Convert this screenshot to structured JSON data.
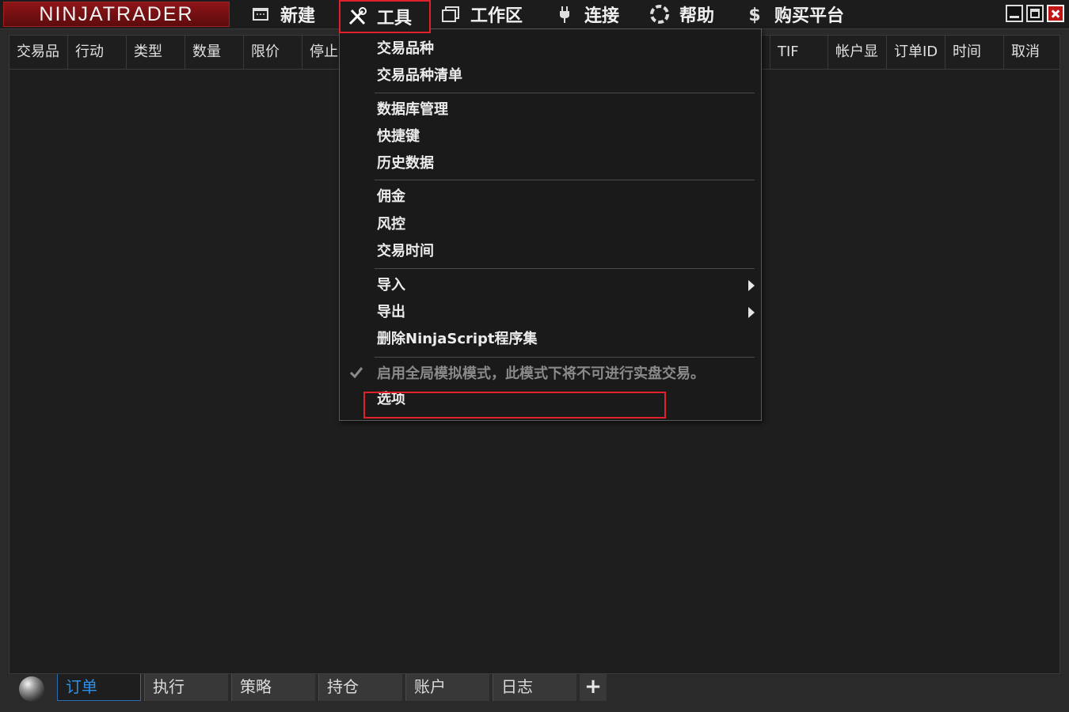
{
  "app": {
    "logo": "NINJATRADER"
  },
  "menubar": {
    "items": [
      {
        "label": "新建",
        "icon": "new-window-icon"
      },
      {
        "label": "工具",
        "icon": "tools-icon"
      },
      {
        "label": "工作区",
        "icon": "workspace-icon"
      },
      {
        "label": "连接",
        "icon": "plug-icon"
      },
      {
        "label": "帮助",
        "icon": "help-lifebuoy-icon"
      },
      {
        "label": "购买平台",
        "icon": "dollar-icon"
      }
    ],
    "window_buttons": [
      "minimize",
      "maximize",
      "close"
    ]
  },
  "grid": {
    "columns": [
      "交易品",
      "行动",
      "类型",
      "数量",
      "限价",
      "停止",
      "TIF",
      "帐户显",
      "订单ID",
      "时间",
      "取消"
    ]
  },
  "dropdown": {
    "groups": [
      [
        "交易品种",
        "交易品种清单"
      ],
      [
        "数据库管理",
        "快捷键",
        "历史数据"
      ],
      [
        "佣金",
        "风控",
        "交易时间"
      ],
      [
        "导入",
        "导出",
        "删除NinjaScript程序集"
      ]
    ],
    "submenu_items": [
      "导入",
      "导出"
    ],
    "disabled_item": "启用全局模拟模式，此模式下将不可进行实盘交易。",
    "last_item": "选项"
  },
  "tabs": {
    "items": [
      "订单",
      "执行",
      "策略",
      "持仓",
      "账户",
      "日志"
    ],
    "active": "订单",
    "add_label": "+"
  },
  "colors": {
    "accent": "#2f8fe8",
    "highlight": "#e0202a",
    "logo": "#8e1518"
  }
}
